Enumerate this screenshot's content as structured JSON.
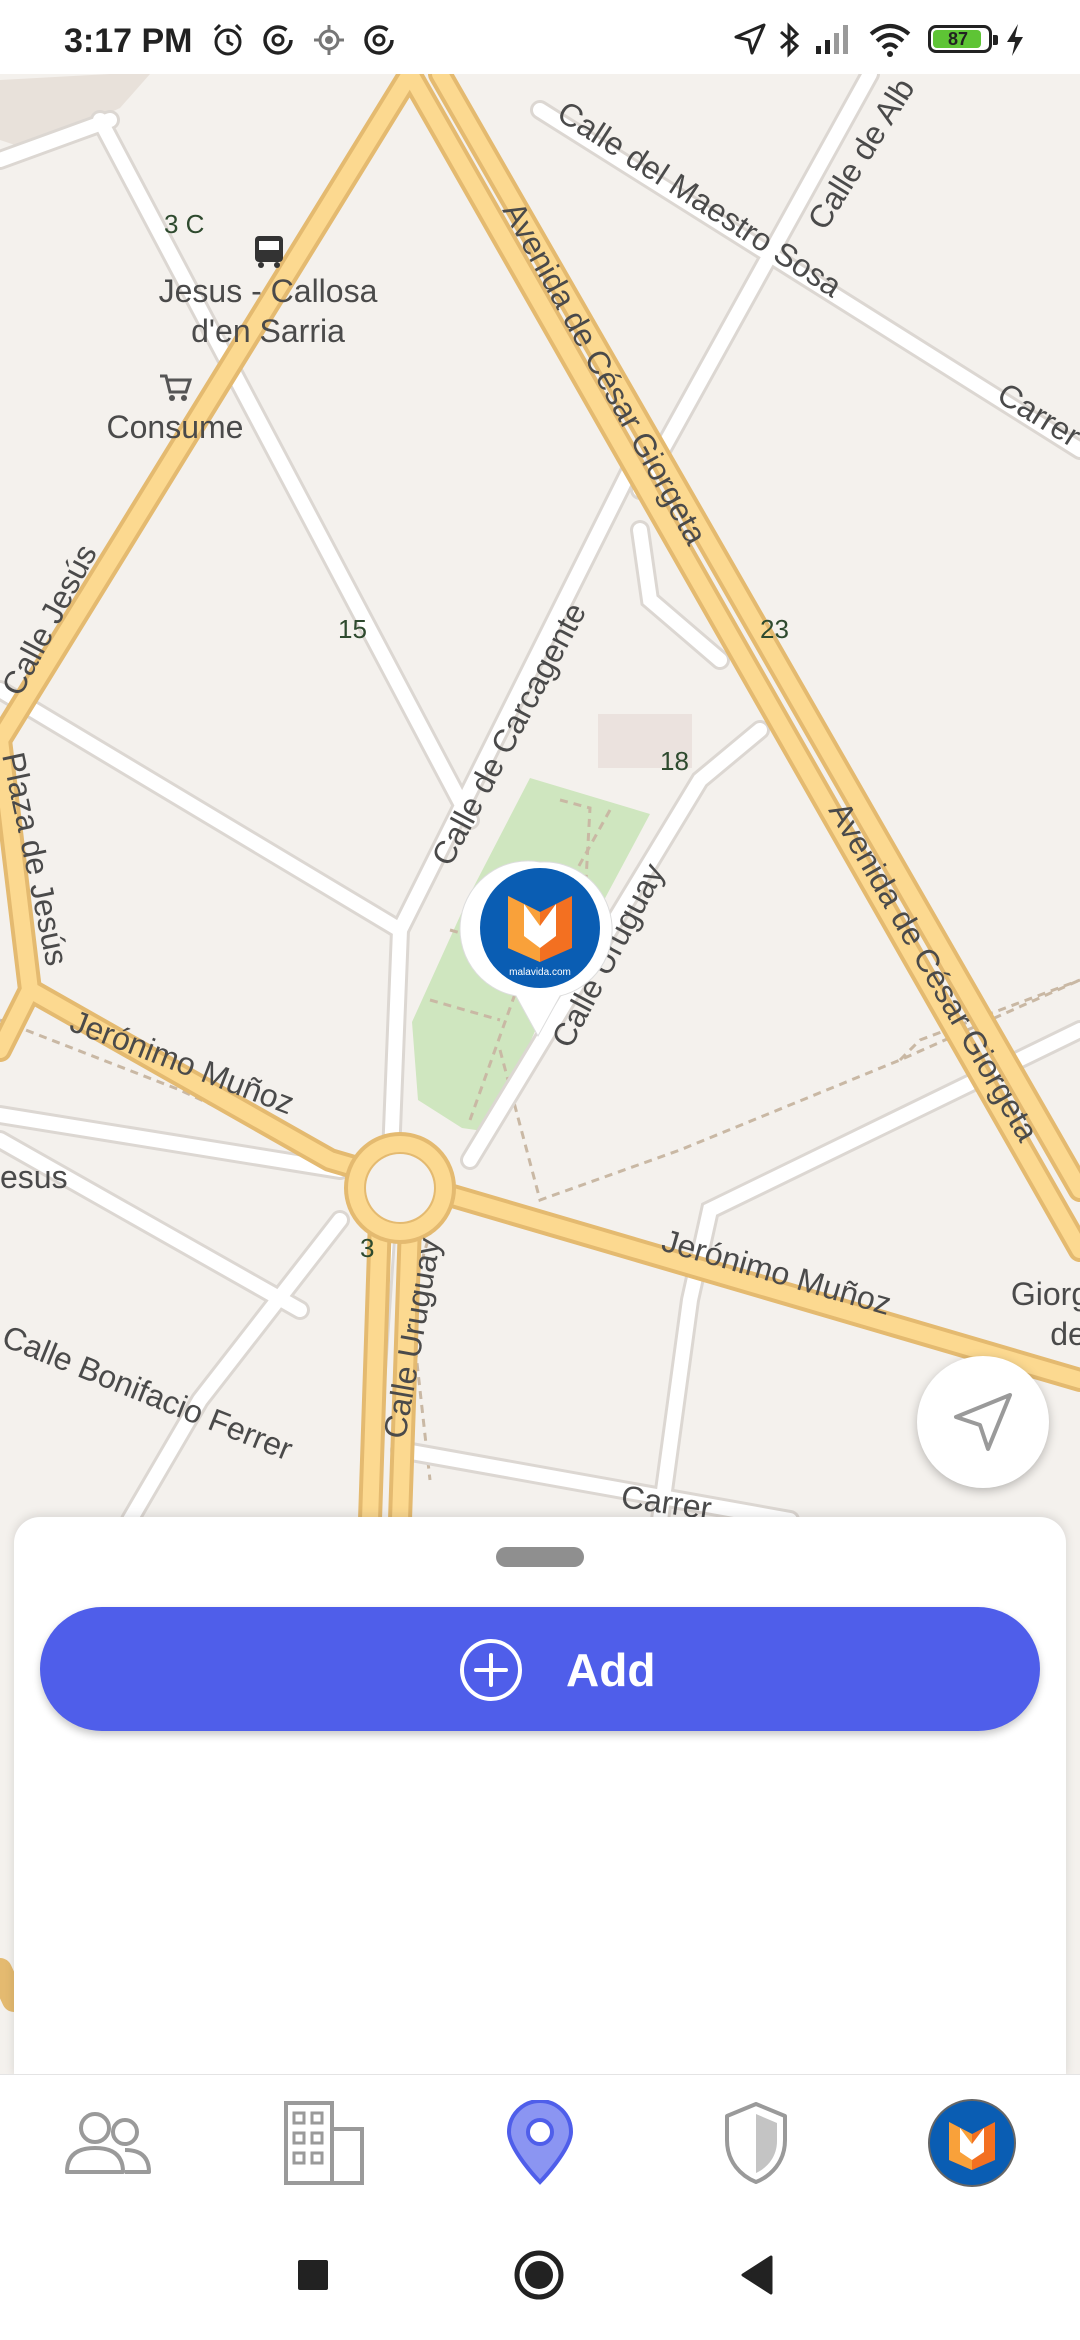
{
  "status_bar": {
    "time": "3:17 PM",
    "battery_level": "87",
    "icons": [
      "alarm-icon",
      "data-saver-icon",
      "location-target-icon",
      "data-saver-icon",
      "navigation-arrow-icon",
      "bluetooth-icon",
      "signal-icon",
      "wifi-icon",
      "battery-icon",
      "charging-bolt-icon"
    ]
  },
  "map": {
    "streets": [
      "Calle del Maestro Sosa",
      "Calle de Alb",
      "Carrer",
      "Avenida de César Giorgeta",
      "Calle Jesús",
      "Plaza de Jesús",
      "Calle de Carcagente",
      "Calle Uruguay",
      "Avenida de César Giorgeta",
      "Jerónimo Muñoz",
      "Jerónimo Muñoz",
      "Calle Uruguay",
      "Calle Bonifacio Ferrer",
      "Carrer",
      "esus"
    ],
    "places": [
      {
        "name_line1": "Jesus - Callosa",
        "name_line2": "d'en Sarria",
        "icon": "bus-stop-icon"
      },
      {
        "name": "Consume",
        "icon": "shopping-cart-icon"
      },
      {
        "name_line1": "Giorg",
        "name_line2": "de"
      }
    ],
    "house_numbers": [
      "3 C",
      "15",
      "23",
      "18",
      "3"
    ],
    "marker": {
      "brand_text": "malavida.com",
      "icon": "malavida-logo-icon"
    }
  },
  "locate_button": {
    "icon": "navigation-arrow-icon"
  },
  "bottom_sheet": {
    "add_button": {
      "label": "Add",
      "icon": "plus-circle-icon"
    }
  },
  "bottom_nav": {
    "items": [
      {
        "id": "people",
        "icon": "people-icon",
        "active": false
      },
      {
        "id": "buildings",
        "icon": "building-icon",
        "active": false
      },
      {
        "id": "map",
        "icon": "location-pin-icon",
        "active": true
      },
      {
        "id": "security",
        "icon": "shield-icon",
        "active": false
      },
      {
        "id": "profile",
        "icon": "malavida-avatar-icon",
        "active": false
      }
    ]
  },
  "system_nav": [
    "recents-square-icon",
    "home-circle-icon",
    "back-triangle-icon"
  ],
  "colors": {
    "accent": "#4f5eea",
    "road_major": "#fcd990",
    "road_major_casing": "#e4ba70",
    "road_minor": "#ffffff",
    "map_bg": "#f4f1ed",
    "park": "#cfe6bf",
    "marker_blue": "#0a5db3",
    "marker_orange": "#f37021",
    "battery_green": "#5ec435"
  }
}
